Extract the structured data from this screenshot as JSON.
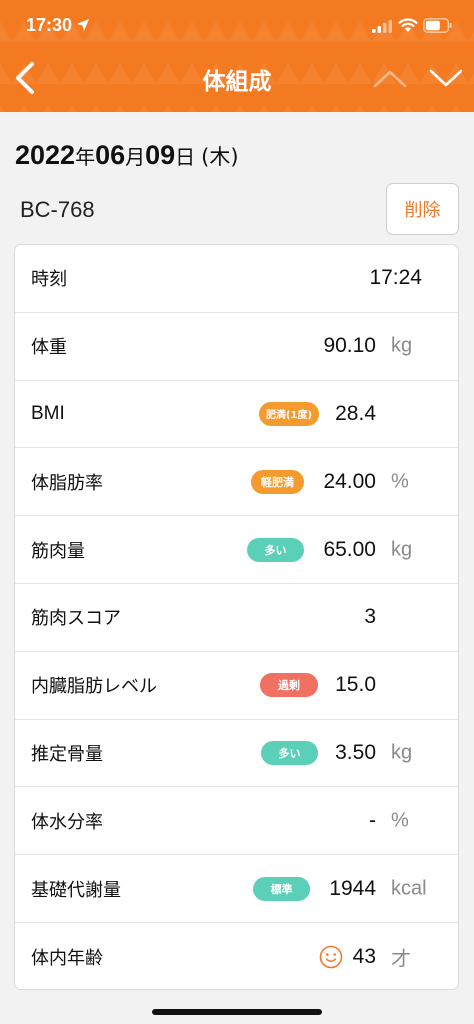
{
  "status_bar": {
    "time": "17:30"
  },
  "nav": {
    "title": "体組成"
  },
  "date": {
    "year": "2022",
    "year_suffix": "年",
    "month": "06",
    "month_suffix": "月",
    "day": "09",
    "day_suffix": "日",
    "weekday": "(木)"
  },
  "device": {
    "name": "BC-768"
  },
  "actions": {
    "delete_label": "削除"
  },
  "colors": {
    "brand": "#f47a22",
    "badge_orange": "#f59a2e",
    "badge_teal": "#5ccfb8",
    "badge_red": "#f07062"
  },
  "rows": [
    {
      "label": "時刻",
      "value": "17:24",
      "unit": "",
      "badge": ""
    },
    {
      "label": "体重",
      "value": "90.10",
      "unit": "kg",
      "badge": ""
    },
    {
      "label": "BMI",
      "value": "28.4",
      "unit": "",
      "badge": "肥満(1度)"
    },
    {
      "label": "体脂肪率",
      "value": "24.00",
      "unit": "%",
      "badge": "軽肥満"
    },
    {
      "label": "筋肉量",
      "value": "65.00",
      "unit": "kg",
      "badge": "多い"
    },
    {
      "label": "筋肉スコア",
      "value": "3",
      "unit": "",
      "badge": ""
    },
    {
      "label": "内臓脂肪レベル",
      "value": "15.0",
      "unit": "",
      "badge": "過剰"
    },
    {
      "label": "推定骨量",
      "value": "3.50",
      "unit": "kg",
      "badge": "多い"
    },
    {
      "label": "体水分率",
      "value": "-",
      "unit": "%",
      "badge": ""
    },
    {
      "label": "基礎代謝量",
      "value": "1944",
      "unit": "kcal",
      "badge": "標準"
    },
    {
      "label": "体内年齢",
      "value": "43",
      "unit": "才",
      "badge": ""
    }
  ]
}
